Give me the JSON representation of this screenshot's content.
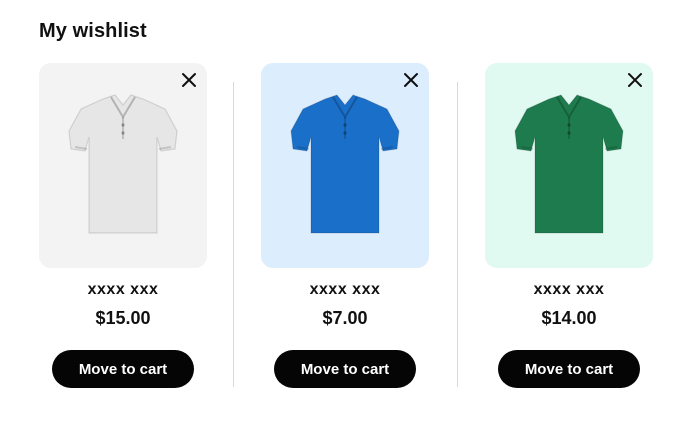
{
  "header": {
    "title": "My wishlist"
  },
  "items": [
    {
      "name": "xxxx xxx",
      "price": "$15.00",
      "action_label": "Move to cart",
      "image_bg": "#f3f3f3",
      "shirt_color": "#e6e6e6",
      "shirt_icon": "white-polo-shirt-icon"
    },
    {
      "name": "xxxx xxx",
      "price": "$7.00",
      "action_label": "Move to cart",
      "image_bg": "#dcedfd",
      "shirt_color": "#1a6fc9",
      "shirt_icon": "blue-polo-shirt-icon"
    },
    {
      "name": "xxxx xxx",
      "price": "$14.00",
      "action_label": "Move to cart",
      "image_bg": "#e0f9f1",
      "shirt_color": "#1e7b4e",
      "shirt_icon": "green-polo-shirt-icon"
    }
  ],
  "remove_icon": "close-icon"
}
